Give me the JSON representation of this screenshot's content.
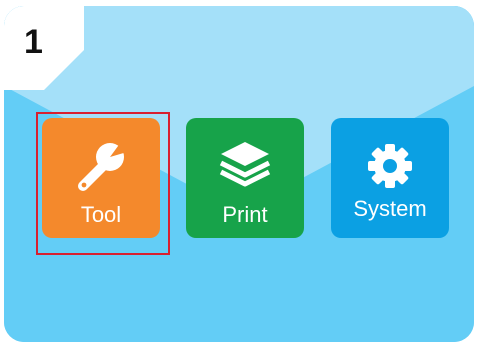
{
  "step": {
    "number": "1"
  },
  "menu": {
    "tiles": [
      {
        "label": "Tool",
        "icon": "wrench-icon",
        "color": "#f4892c"
      },
      {
        "label": "Print",
        "icon": "layers-icon",
        "color": "#17a34a"
      },
      {
        "label": "System",
        "icon": "gear-icon",
        "color": "#0ba0e3"
      }
    ],
    "selected": "Tool"
  },
  "colors": {
    "background": "#63cdf6",
    "background_light": "#a4e0f9",
    "highlight": "#d8202f"
  }
}
